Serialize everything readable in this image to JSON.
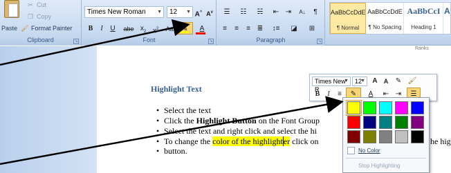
{
  "clipboard": {
    "paste": "Paste",
    "cut": "Cut",
    "copy": "Copy",
    "format_painter": "Format Painter",
    "label": "Clipboard"
  },
  "font": {
    "face": "Times New Roman",
    "size": "12",
    "grow": "A",
    "shrink": "A",
    "bold": "B",
    "italic": "I",
    "underline": "U",
    "strike": "abe",
    "subscript": "x",
    "superscript": "x",
    "font_color": "A",
    "label": "Font",
    "highlight_color": "#ffff00",
    "font_color_value": "#ff0000"
  },
  "paragraph": {
    "label": "Paragraph"
  },
  "styles": {
    "tiles": [
      {
        "sample": "AaBbCcDdE",
        "name": "¶ Normal"
      },
      {
        "sample": "AaBbCcDdE",
        "name": "¶ No Spacing"
      },
      {
        "sample": "AaBbCcI",
        "name": "Heading 1"
      },
      {
        "sample": "A",
        "name": ""
      }
    ]
  },
  "ruler": {
    "text": "Ranks"
  },
  "doc": {
    "heading": "Highlight Text",
    "bullets": [
      {
        "text": "Select the text"
      },
      {
        "pre": "Click the ",
        "bold": "Highlight  Button",
        "post": "  on the Font Group"
      },
      {
        "text": "Select the text and right click and select the hi"
      },
      {
        "pre": "To change the ",
        "hl1": "color of the highlight",
        "hl2": "er",
        "post": " click on",
        "tail": "he high"
      },
      {
        "text": "button."
      }
    ]
  },
  "mini_toolbar": {
    "font": "Times New R",
    "size": "12",
    "bold": "B",
    "italic": "I"
  },
  "palette": {
    "colors": [
      "#ffff00",
      "#00ff00",
      "#00ffff",
      "#ff00ff",
      "#0000ff",
      "#ff0000",
      "#000080",
      "#008080",
      "#008000",
      "#800080",
      "#800000",
      "#808000",
      "#808080",
      "#c0c0c0",
      "#000000"
    ],
    "no_color": "No Color",
    "stop": "Stop Highlighting"
  }
}
